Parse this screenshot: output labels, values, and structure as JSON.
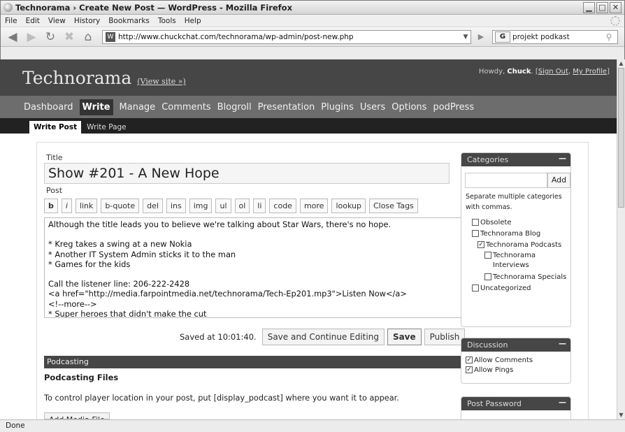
{
  "window": {
    "title": "Technorama › Create New Post — WordPress - Mozilla Firefox"
  },
  "menus": [
    "File",
    "Edit",
    "View",
    "History",
    "Bookmarks",
    "Tools",
    "Help"
  ],
  "address": {
    "url": "http://www.chuckchat.com/technorama/wp-admin/post-new.php"
  },
  "search": {
    "engine": "G",
    "query": "projekt podkast"
  },
  "status": {
    "text": "Done"
  },
  "wp": {
    "site_title": "Technorama",
    "view_site": "(View site »)",
    "howdy": {
      "prefix": "Howdy, ",
      "user": "Chuck",
      "sep": ". [",
      "signout": "Sign Out",
      "comma": ", ",
      "profile": "My Profile",
      "end": "]"
    },
    "nav": [
      "Dashboard",
      "Write",
      "Manage",
      "Comments",
      "Blogroll",
      "Presentation",
      "Plugins",
      "Users",
      "Options",
      "podPress"
    ],
    "nav_active": "Write",
    "subnav": [
      "Write Post",
      "Write Page"
    ],
    "subnav_active": "Write Post"
  },
  "post": {
    "title_label": "Title",
    "title_value": "Show #201 - A New Hope",
    "post_label": "Post",
    "quicktags": [
      "b",
      "i",
      "link",
      "b-quote",
      "del",
      "ins",
      "img",
      "ul",
      "ol",
      "li",
      "code",
      "more",
      "lookup",
      "Close Tags"
    ],
    "content_lines": [
      "Although the title leads you to believe we're talking about Star Wars, there's no hope.",
      "",
      "* Kreg takes a swing at a new Nokia",
      "* Another IT System Admin sticks it to the man",
      "* Games for the kids",
      "",
      "Call the listener line: 206-222-2428",
      "<a href=\"http://media.farpointmedia.net/technorama/Tech-Ep201.mp3\">Listen Now</a>",
      "<!--more-->",
      "* Super heroes that didn't make the cut"
    ],
    "saved_text": "Saved at 10:01:40.",
    "buttons": {
      "save_continue": "Save and Continue Editing",
      "save": "Save",
      "publish": "Publish"
    }
  },
  "podcasting": {
    "header": "Podcasting",
    "files_title": "Podcasting Files",
    "instructions": "To control player location in your post, put [display_podcast] where you want it to appear.",
    "add_media": "Add Media File"
  },
  "sidebar": {
    "categories": {
      "header": "Categories",
      "add_label": "Add",
      "help": "Separate multiple categories with commas.",
      "items": [
        {
          "label": "Obsolete",
          "checked": false
        },
        {
          "label": "Technorama Blog",
          "checked": false
        },
        {
          "label": "Technorama Podcasts",
          "checked": true
        },
        {
          "label": "Technorama Interviews",
          "checked": false
        },
        {
          "label": "Technorama Specials",
          "checked": false
        },
        {
          "label": "Uncategorized",
          "checked": false
        }
      ]
    },
    "discussion": {
      "header": "Discussion",
      "allow_comments": "Allow Comments",
      "allow_pings": "Allow Pings"
    },
    "password": {
      "header": "Post Password"
    },
    "minimize_glyph": "—"
  }
}
